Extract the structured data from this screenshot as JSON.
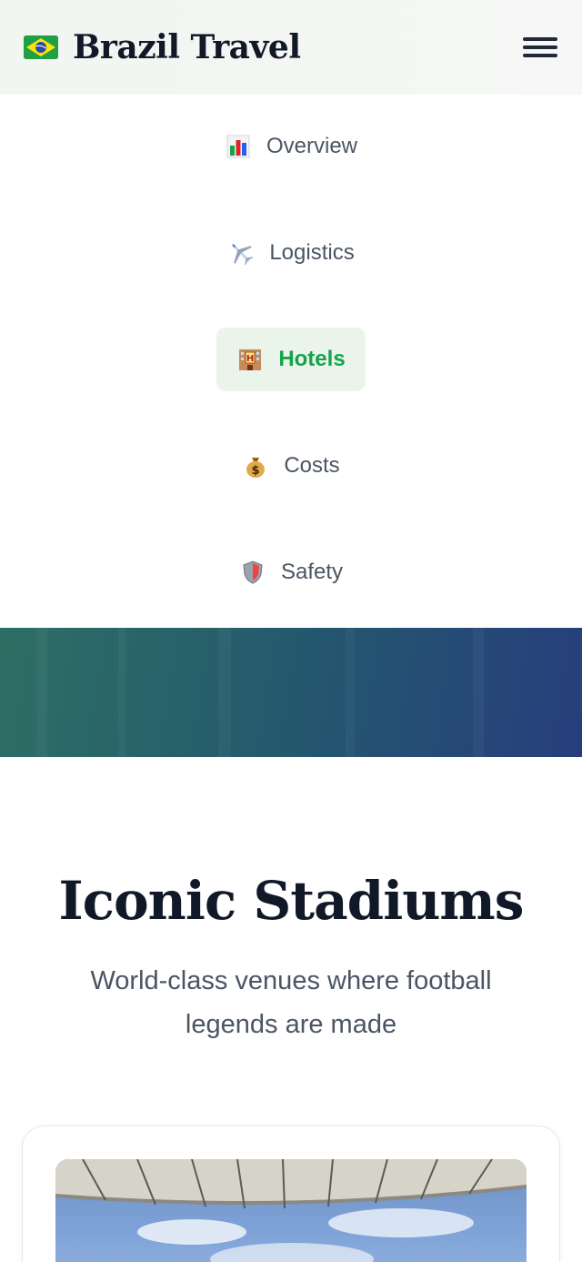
{
  "header": {
    "brand_title": "Brazil Travel",
    "flag_icon": "brazil-flag-icon",
    "menu_icon": "hamburger-menu-icon"
  },
  "nav": {
    "items": [
      {
        "label": "Overview",
        "icon": "bar-chart-icon",
        "active": false
      },
      {
        "label": "Logistics",
        "icon": "airplane-icon",
        "active": false
      },
      {
        "label": "Hotels",
        "icon": "hotel-icon",
        "active": true
      },
      {
        "label": "Costs",
        "icon": "money-bag-icon",
        "active": false
      },
      {
        "label": "Safety",
        "icon": "shield-icon",
        "active": false
      }
    ]
  },
  "section": {
    "title": "Iconic Stadiums",
    "subtitle": "World-class venues where football legends are made"
  },
  "colors": {
    "accent_green": "#16a34a",
    "active_bg": "#eaf4ea",
    "hero_gradient_start": "#2d6f64",
    "hero_gradient_end": "#273e7d"
  }
}
